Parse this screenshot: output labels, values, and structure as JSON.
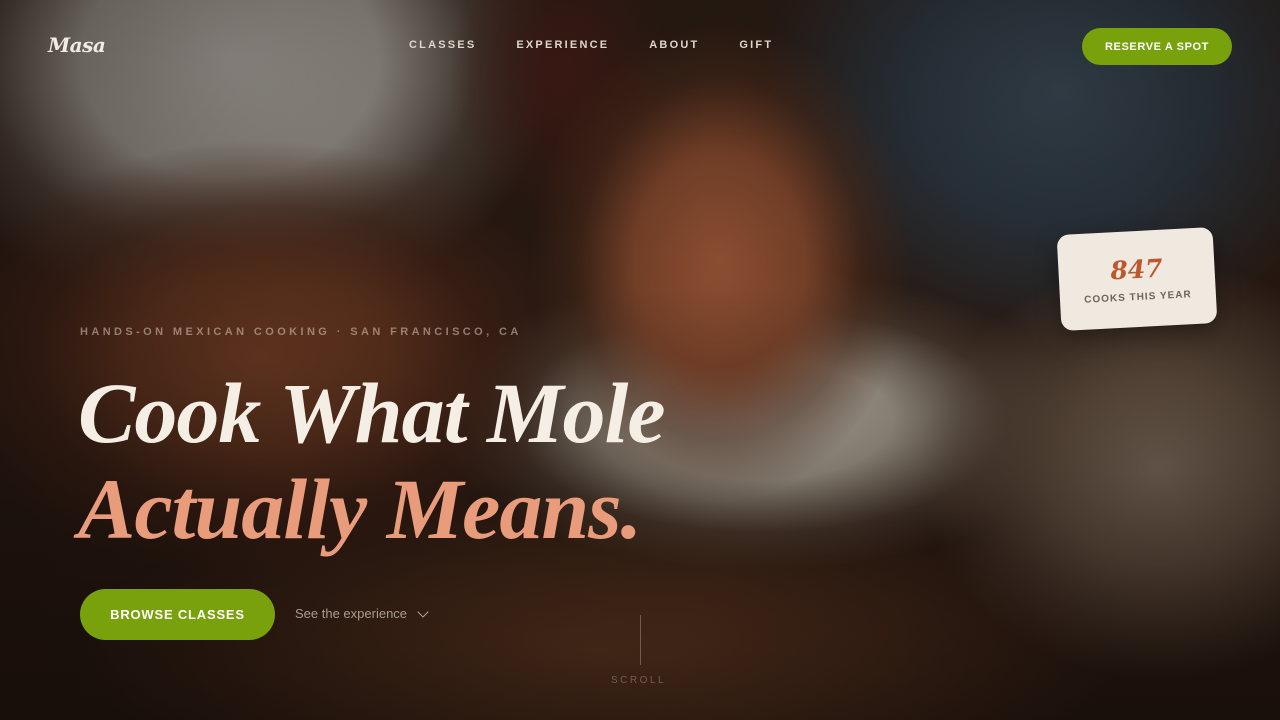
{
  "brand": {
    "logo": "Masa"
  },
  "nav": {
    "items": [
      {
        "label": "CLASSES"
      },
      {
        "label": "EXPERIENCE"
      },
      {
        "label": "ABOUT"
      },
      {
        "label": "GIFT"
      }
    ],
    "cta_label": "RESERVE A SPOT"
  },
  "stat": {
    "value": "847",
    "label": "COOKS THIS YEAR"
  },
  "hero": {
    "eyebrow": "HANDS-ON MEXICAN COOKING · SAN FRANCISCO, CA",
    "headline_line1": "Cook What Mole",
    "headline_line2": "Actually Means.",
    "primary_button": "BROWSE CLASSES",
    "secondary_link": "See the experience",
    "scroll_label": "SCROLL"
  },
  "colors": {
    "accent_green": "#78a10c",
    "headline_cream": "#f4eee4",
    "headline_peach": "#e89c7c",
    "stat_orange": "#c0562e"
  }
}
